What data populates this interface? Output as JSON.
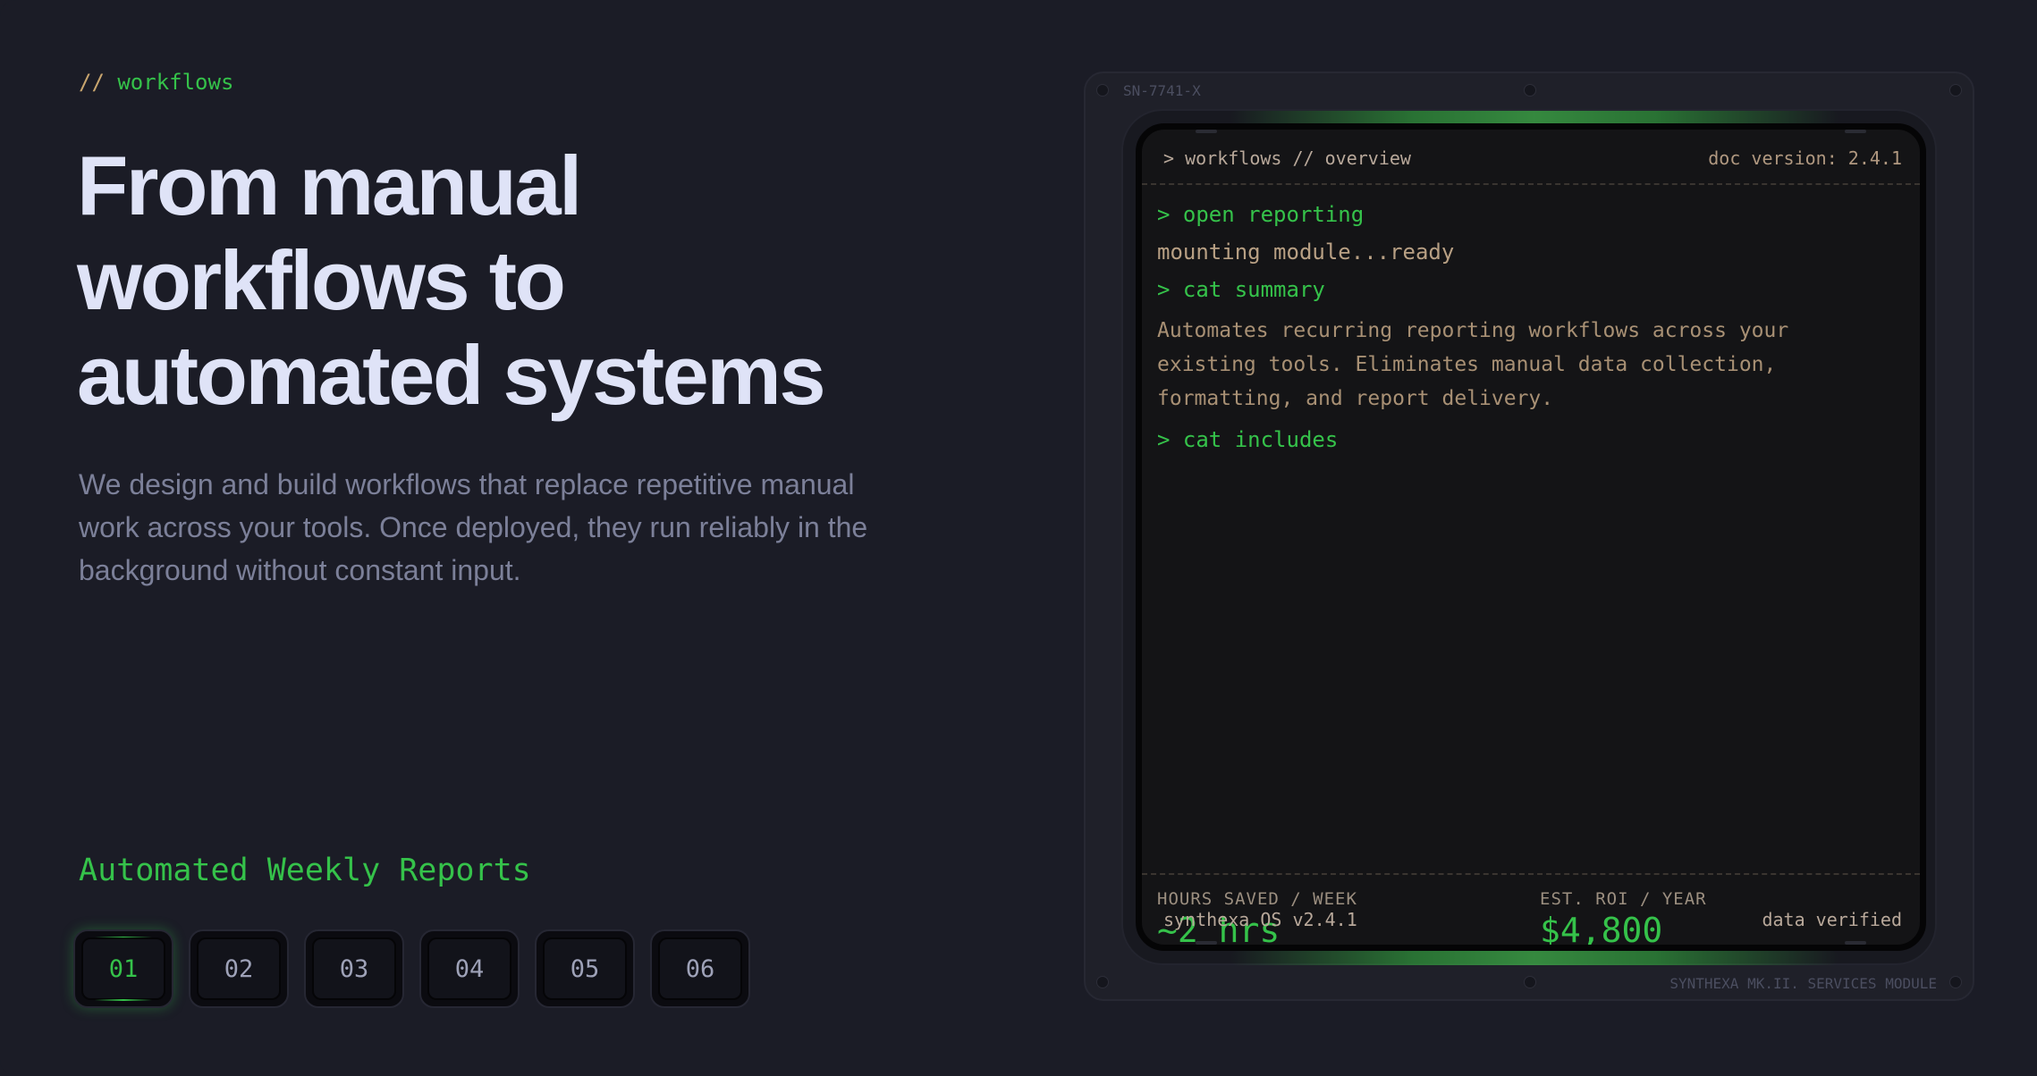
{
  "section": {
    "eyebrow_prefix": "//",
    "eyebrow_label": "workflows"
  },
  "hero": {
    "headline_lines": [
      "From manual",
      "workflows to",
      "automated systems"
    ],
    "description_lines": [
      "We design and build workflows that replace repetitive manual",
      "work across your tools. Once deployed, they run reliably in the",
      "background without constant input."
    ]
  },
  "service": {
    "title": "Automated Weekly Reports",
    "steps": [
      "01",
      "02",
      "03",
      "04",
      "05",
      "06"
    ],
    "active_step": "01"
  },
  "device": {
    "serial": "SN-7741-X",
    "module_label": "SYNTHEXA MK.II. SERVICES MODULE",
    "header_path": "> workflows // overview",
    "doc_version": "doc version: 2.4.1",
    "console": {
      "cmd_open": "> open reporting",
      "out_mount": "mounting module...ready",
      "cmd_summary": "> cat summary",
      "summary_lines": [
        "Automates recurring reporting workflows across your",
        "existing tools. Eliminates manual data collection,",
        "formatting, and report delivery."
      ],
      "cmd_includes": "> cat includes"
    },
    "stats": {
      "hours_label": "HOURS SAVED / WEEK",
      "hours_value": "~2 hrs",
      "roi_label": "EST. ROI / YEAR",
      "roi_value": "$4,800"
    },
    "footer_os": "synthexa OS v2.4.1",
    "footer_status": "data verified"
  },
  "colors": {
    "background": "#1b1c26",
    "accent_green": "#35c24a",
    "headline": "#dfe3f7",
    "body_text": "#7c8099",
    "terminal_text": "#b8a084"
  }
}
